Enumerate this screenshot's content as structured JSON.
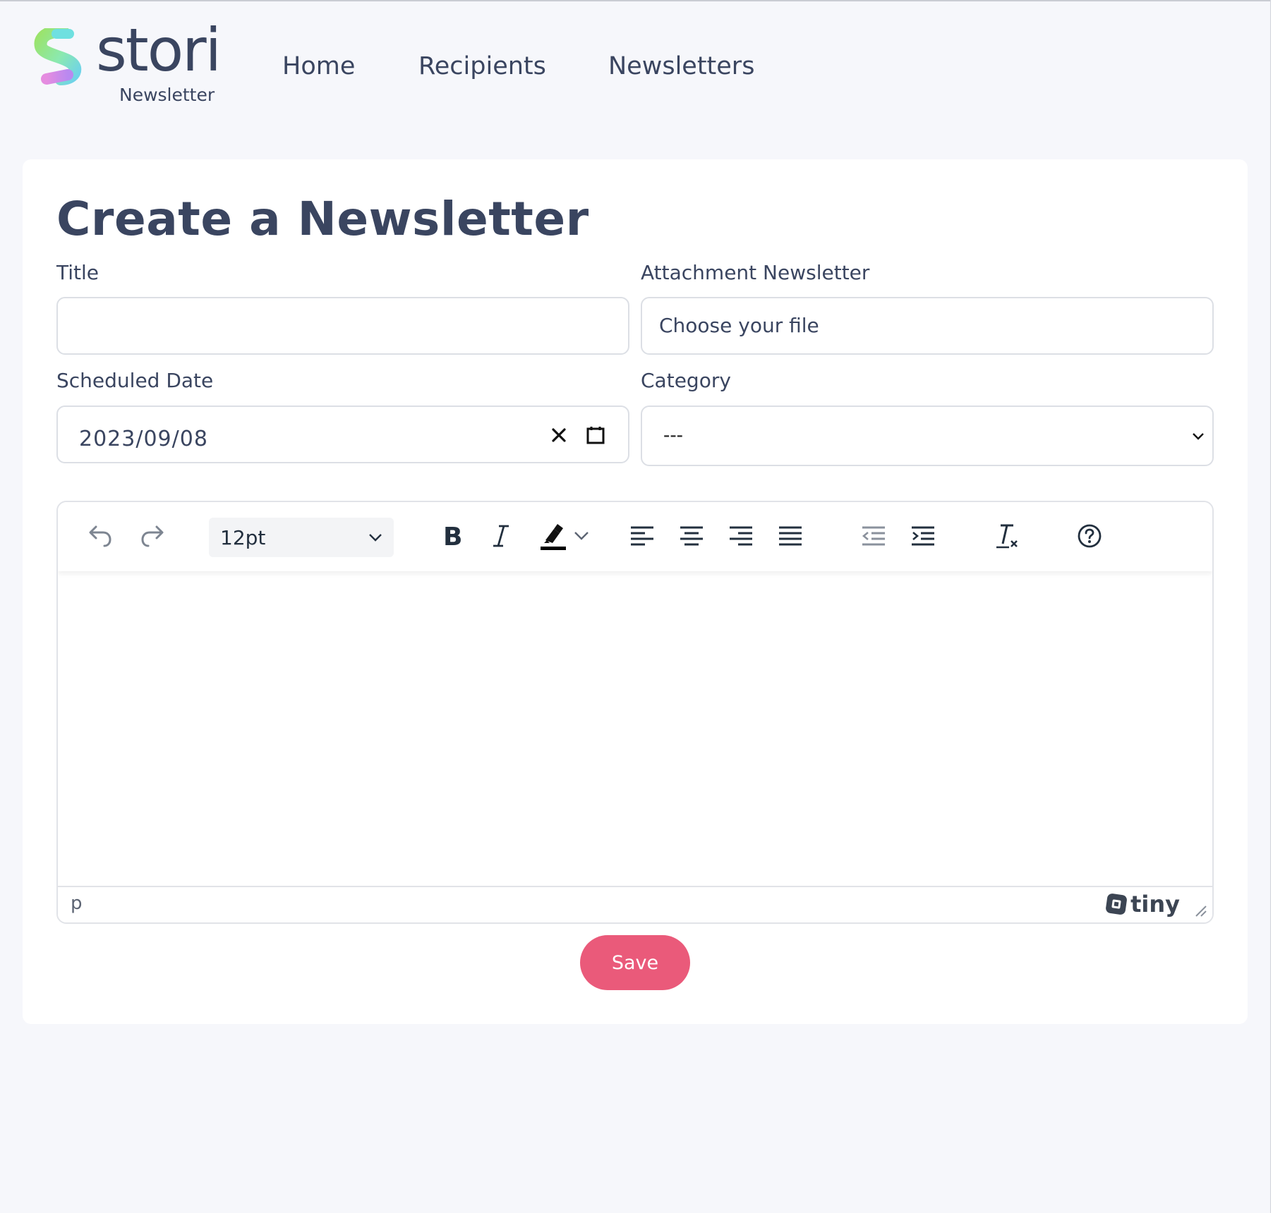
{
  "brand": {
    "name": "stori",
    "subtitle": "Newsletter"
  },
  "nav": {
    "items": [
      "Home",
      "Recipients",
      "Newsletters"
    ]
  },
  "page": {
    "title": "Create a Newsletter"
  },
  "form": {
    "title_label": "Title",
    "title_value": "",
    "attachment_label": "Attachment Newsletter",
    "attachment_placeholder": "Choose your file",
    "date_label": "Scheduled Date",
    "date_value": "2023/09/08",
    "category_label": "Category",
    "category_value": "---"
  },
  "editor": {
    "font_size": "12pt",
    "status_path": "p",
    "brand": "tiny",
    "toolbar_icons": [
      "undo-icon",
      "redo-icon",
      "bold-icon",
      "italic-icon",
      "highlight-icon",
      "align-left-icon",
      "align-center-icon",
      "align-right-icon",
      "align-justify-icon",
      "outdent-icon",
      "indent-icon",
      "remove-format-icon",
      "help-icon"
    ]
  },
  "actions": {
    "save_label": "Save"
  },
  "colors": {
    "accent": "#ea5a7a",
    "text": "#3a4560",
    "background": "#f6f7fb"
  }
}
